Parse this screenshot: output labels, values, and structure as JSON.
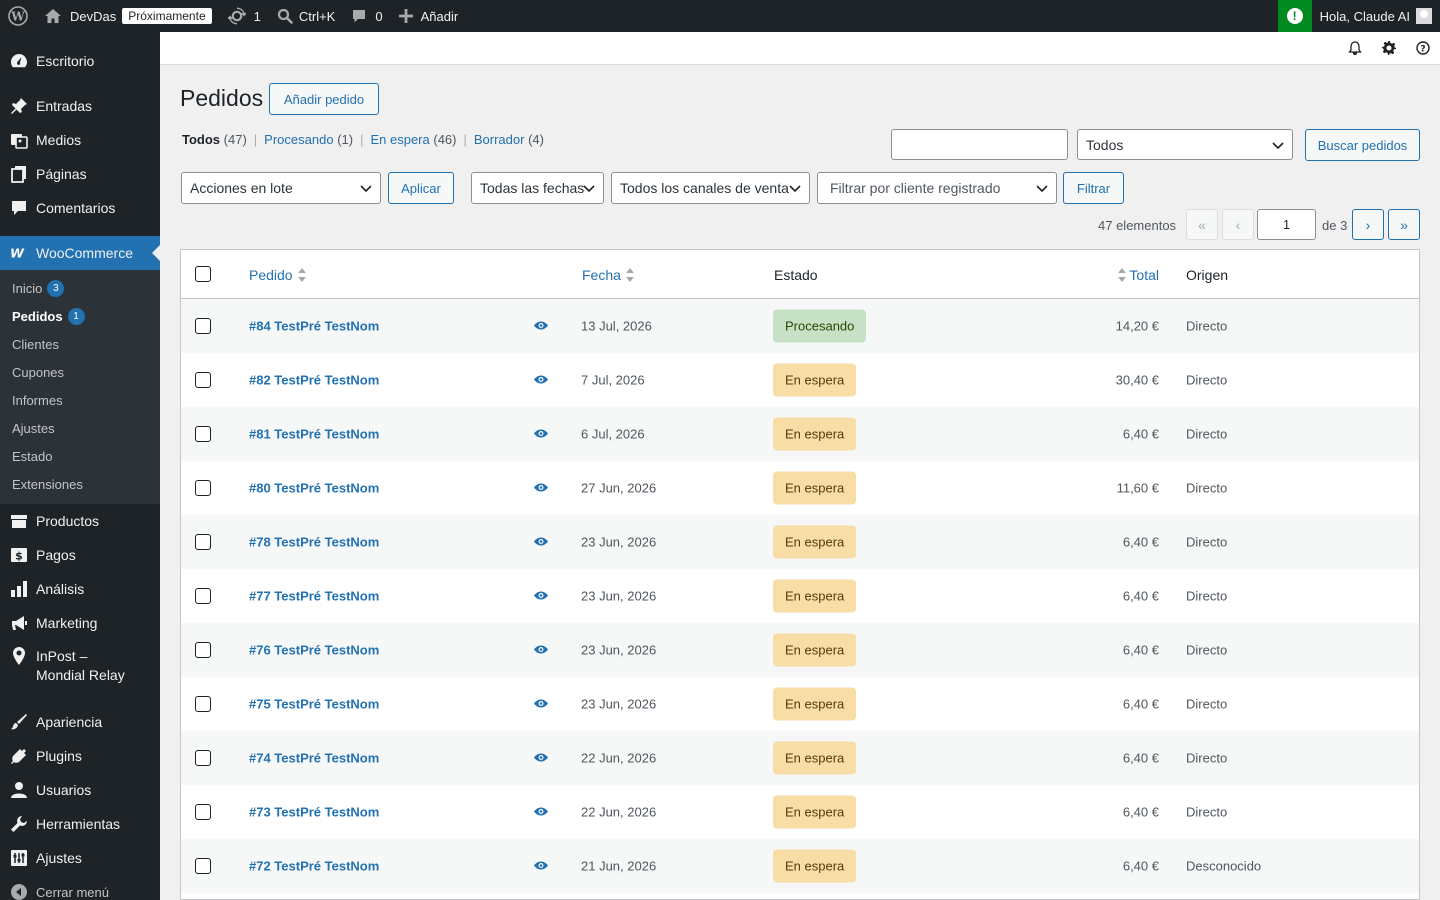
{
  "adminbar": {
    "site_name": "DevDas",
    "site_badge": "Próximamente",
    "updates_count": "1",
    "shortcut": "Ctrl+K",
    "comments_count": "0",
    "add_new": "Añadir",
    "greeting": "Hola, Claude AI"
  },
  "sidebar": {
    "dashboard": "Escritorio",
    "posts": "Entradas",
    "media": "Medios",
    "pages": "Páginas",
    "comments": "Comentarios",
    "woocommerce": "WooCommerce",
    "woo_sub": {
      "home": "Inicio",
      "home_count": "3",
      "orders": "Pedidos",
      "orders_count": "1",
      "customers": "Clientes",
      "coupons": "Cupones",
      "reports": "Informes",
      "settings": "Ajustes",
      "status": "Estado",
      "extensions": "Extensiones"
    },
    "products": "Productos",
    "payments": "Pagos",
    "analytics": "Análisis",
    "marketing": "Marketing",
    "inpost_line1": "InPost –",
    "inpost_line2": "Mondial Relay",
    "appearance": "Apariencia",
    "plugins": "Plugins",
    "users": "Usuarios",
    "tools": "Herramientas",
    "settings": "Ajustes",
    "collapse": "Cerrar menú"
  },
  "page": {
    "title": "Pedidos",
    "add_order": "Añadir pedido"
  },
  "views": {
    "all": "Todos",
    "all_count": "(47)",
    "processing": "Procesando",
    "processing_count": "(1)",
    "on_hold": "En espera",
    "on_hold_count": "(46)",
    "draft": "Borrador",
    "draft_count": "(4)"
  },
  "search": {
    "value": "",
    "type_select": "Todos",
    "button": "Buscar pedidos"
  },
  "filters": {
    "bulk_actions": "Acciones en lote",
    "apply": "Aplicar",
    "dates": "Todas las fechas",
    "channels": "Todos los canales de venta",
    "customer": "Filtrar por cliente registrado",
    "filter": "Filtrar"
  },
  "pagination": {
    "items": "47 elementos",
    "first": "«",
    "prev": "‹",
    "current": "1",
    "of": "de 3",
    "next": "›",
    "last": "»"
  },
  "table": {
    "columns": {
      "order": "Pedido",
      "date": "Fecha",
      "status": "Estado",
      "total": "Total",
      "origin": "Origen"
    },
    "rows": [
      {
        "order": "#84 TestPré TestNom",
        "date": "13 Jul, 2026",
        "status": "Procesando",
        "status_type": "processing",
        "total": "14,20 €",
        "origin": "Directo"
      },
      {
        "order": "#82 TestPré TestNom",
        "date": "7 Jul, 2026",
        "status": "En espera",
        "status_type": "on-hold",
        "total": "30,40 €",
        "origin": "Directo"
      },
      {
        "order": "#81 TestPré TestNom",
        "date": "6 Jul, 2026",
        "status": "En espera",
        "status_type": "on-hold",
        "total": "6,40 €",
        "origin": "Directo"
      },
      {
        "order": "#80 TestPré TestNom",
        "date": "27 Jun, 2026",
        "status": "En espera",
        "status_type": "on-hold",
        "total": "11,60 €",
        "origin": "Directo"
      },
      {
        "order": "#78 TestPré TestNom",
        "date": "23 Jun, 2026",
        "status": "En espera",
        "status_type": "on-hold",
        "total": "6,40 €",
        "origin": "Directo"
      },
      {
        "order": "#77 TestPré TestNom",
        "date": "23 Jun, 2026",
        "status": "En espera",
        "status_type": "on-hold",
        "total": "6,40 €",
        "origin": "Directo"
      },
      {
        "order": "#76 TestPré TestNom",
        "date": "23 Jun, 2026",
        "status": "En espera",
        "status_type": "on-hold",
        "total": "6,40 €",
        "origin": "Directo"
      },
      {
        "order": "#75 TestPré TestNom",
        "date": "23 Jun, 2026",
        "status": "En espera",
        "status_type": "on-hold",
        "total": "6,40 €",
        "origin": "Directo"
      },
      {
        "order": "#74 TestPré TestNom",
        "date": "22 Jun, 2026",
        "status": "En espera",
        "status_type": "on-hold",
        "total": "6,40 €",
        "origin": "Directo"
      },
      {
        "order": "#73 TestPré TestNom",
        "date": "22 Jun, 2026",
        "status": "En espera",
        "status_type": "on-hold",
        "total": "6,40 €",
        "origin": "Directo"
      },
      {
        "order": "#72 TestPré TestNom",
        "date": "21 Jun, 2026",
        "status": "En espera",
        "status_type": "on-hold",
        "total": "6,40 €",
        "origin": "Desconocido"
      }
    ]
  },
  "colors": {
    "accent": "#2271b1",
    "adminbar": "#1d2327",
    "processing_bg": "#c6e1c6",
    "on_hold_bg": "#f8dda7"
  }
}
